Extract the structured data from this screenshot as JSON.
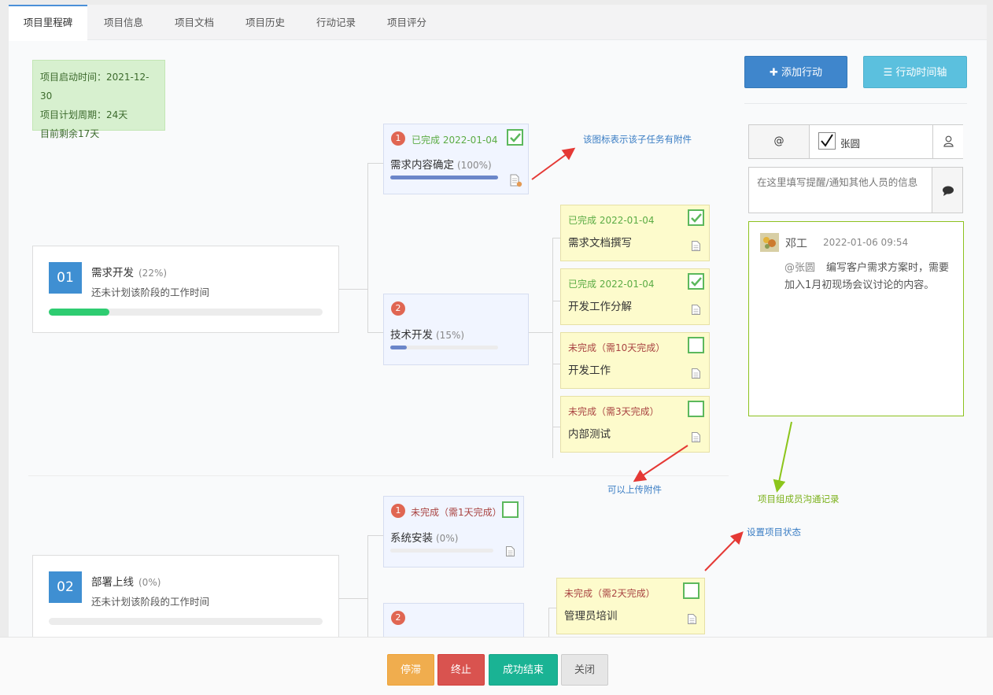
{
  "tabs": [
    {
      "label": "项目里程碑"
    },
    {
      "label": "项目信息"
    },
    {
      "label": "项目文档"
    },
    {
      "label": "项目历史"
    },
    {
      "label": "行动记录"
    },
    {
      "label": "项目评分"
    }
  ],
  "info": {
    "start": "项目启动时间：2021-12-30",
    "cycle": "项目计划周期：24天",
    "remaining": "目前剩余17天"
  },
  "actions": {
    "add": "添加行动",
    "timeline": "行动时间轴"
  },
  "phases": [
    {
      "num": "01",
      "title": "需求开发",
      "pct": "(22%)",
      "note": "还未计划该阶段的工作时间",
      "progress": 0.22,
      "color": "#2ecc71"
    },
    {
      "num": "02",
      "title": "部署上线",
      "pct": "(0%)",
      "note": "还未计划该阶段的工作时间",
      "progress": 0.0,
      "color": "#2ecc71"
    }
  ],
  "tasks": {
    "t1": {
      "num": "1",
      "status": "已完成 2022-01-04",
      "name": "需求内容确定",
      "pct": "(100%)",
      "progress": 1.0,
      "color": "#6b86c9"
    },
    "t2": {
      "num": "2",
      "name": "技术开发",
      "pct": "(15%)",
      "progress": 0.15,
      "color": "#6b86c9"
    },
    "t3": {
      "num": "1",
      "status": "未完成（需1天完成）",
      "name": "系统安装",
      "pct": "(0%)",
      "progress": 0.0
    },
    "t4": {
      "num": "2"
    }
  },
  "subtasks": [
    {
      "status": "已完成 2022-01-04",
      "name": "需求文档撰写",
      "done": true
    },
    {
      "status": "已完成 2022-01-04",
      "name": "开发工作分解",
      "done": true
    },
    {
      "status": "未完成（需10天完成）",
      "name": "开发工作",
      "done": false
    },
    {
      "status": "未完成（需3天完成）",
      "name": "内部测试",
      "done": false
    },
    {
      "status": "未完成（需2天完成）",
      "name": "管理员培训",
      "done": false
    }
  ],
  "annotations": {
    "attachment_icon": "该图标表示该子任务有附件",
    "upload": "可以上传附件",
    "chat": "项目组成员沟通记录",
    "status": "设置项目状态"
  },
  "mention": {
    "at_label": "@",
    "member": "张圆",
    "placeholder": "在这里填写提醒/通知其他人员的信息"
  },
  "chat": {
    "author": "邓工",
    "time": "2022-01-06 09:54",
    "mention": "@张圆",
    "message": "编写客户需求方案时，需要加入1月初现场会议讨论的内容。"
  },
  "footer": {
    "pause": "停滞",
    "stop": "终止",
    "success": "成功结束",
    "close": "关闭"
  },
  "colors": {
    "accent": "#4a90d9",
    "phase_badge": "#3f8fd2",
    "badge": "#e06652",
    "done_check": "#5cb85c",
    "pause": "#f0ad4e",
    "stop": "#d9534f",
    "success": "#1ab394"
  }
}
